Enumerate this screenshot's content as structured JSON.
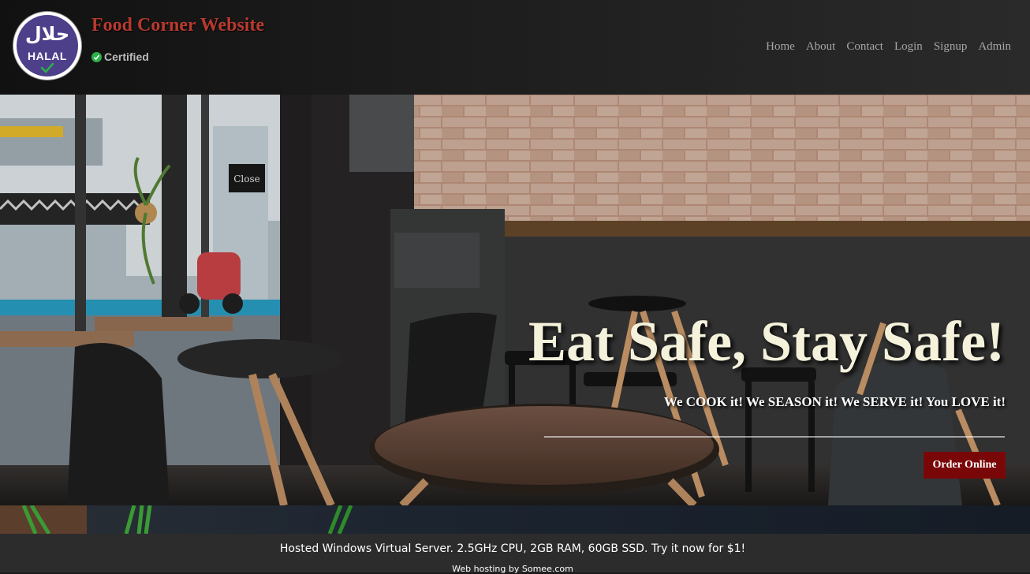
{
  "header": {
    "logo": {
      "arabic_text": "حلال",
      "text": "HALAL"
    },
    "site_title": "Food Corner Website",
    "certified_label": "Certified",
    "nav": [
      "Home",
      "About",
      "Contact",
      "Login",
      "Signup",
      "Admin"
    ]
  },
  "hero": {
    "heading": "Eat Safe, Stay Safe!",
    "subheading": "We COOK it! We SEASON it! We SERVE it! You LOVE it!",
    "order_button": "Order Online",
    "sign_text": "Close"
  },
  "footer": {
    "ad_text": "Hosted Windows Virtual Server. 2.5GHz CPU, 2GB RAM, 60GB SSD. Try it now for $1!",
    "hosting_text": "Web hosting by Somee.com"
  },
  "colors": {
    "title_red": "#b73a2e",
    "button_maroon": "#7a0708",
    "certified_green": "#2bb04a",
    "heading_cream": "#f5f2dc"
  }
}
